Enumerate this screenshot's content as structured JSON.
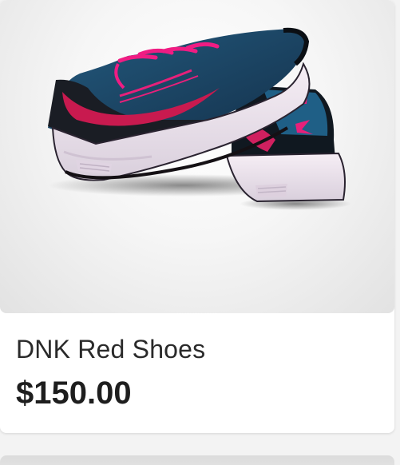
{
  "product": {
    "image_icon": "running-shoes-pair-image",
    "title": "DNK Red Shoes",
    "price": "$150.00"
  },
  "colors": {
    "shoe_body": "#1c2a3c",
    "shoe_mesh": "#1f5f86",
    "accent_pink": "#e8207a",
    "sole": "#ece3ee",
    "card_bg": "#ffffff",
    "page_bg": "#f3f3f3",
    "text": "#2a2a2a"
  }
}
